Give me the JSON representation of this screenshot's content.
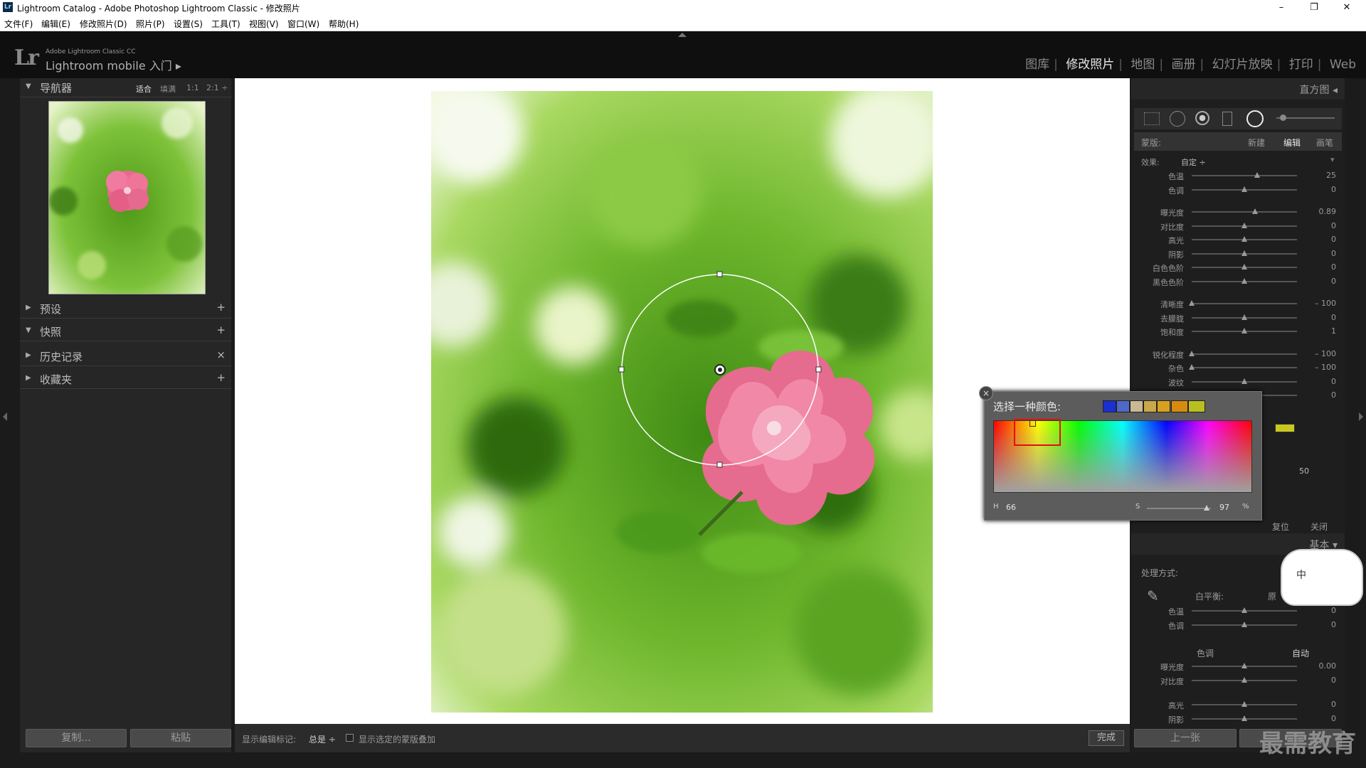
{
  "window": {
    "title": "Lightroom Catalog - Adobe Photoshop Lightroom Classic - 修改照片",
    "app_icon": "Lr",
    "controls": {
      "minimize": "–",
      "maximize": "❐",
      "close": "✕"
    }
  },
  "menu": [
    "文件(F)",
    "编辑(E)",
    "修改照片(D)",
    "照片(P)",
    "设置(S)",
    "工具(T)",
    "视图(V)",
    "窗口(W)",
    "帮助(H)"
  ],
  "brand": {
    "logo": "Lr",
    "small": "Adobe Lightroom Classic CC",
    "big": "Lightroom mobile 入门 ▸"
  },
  "modules": [
    "图库",
    "修改照片",
    "地图",
    "画册",
    "幻灯片放映",
    "打印",
    "Web"
  ],
  "active_module": "修改照片",
  "left_panel": {
    "navigator": {
      "label": "导航器",
      "zoom": [
        "适合",
        "填满",
        "1:1",
        "2:1 ÷"
      ]
    },
    "sections": [
      {
        "label": "预设",
        "action": "+"
      },
      {
        "label": "快照",
        "action": "+"
      },
      {
        "label": "历史记录",
        "action": "×"
      },
      {
        "label": "收藏夹",
        "action": "+"
      }
    ],
    "copy_button": "复制...",
    "paste_button": "粘贴"
  },
  "bottom_toolbar": {
    "show_markers_label": "显示编辑标记:",
    "show_markers_value": "总是 ÷",
    "overlay_label": "显示选定的蒙版叠加",
    "done_button": "完成"
  },
  "right_panel": {
    "histogram_label": "直方图 ◂",
    "mask": {
      "label": "蒙版:",
      "new": "新建",
      "edit": "编辑",
      "brush": "画笔"
    },
    "effect": {
      "label": "效果:",
      "value": "自定 ÷"
    },
    "sliders_group1": [
      {
        "label": "色温",
        "value": "25",
        "pos": 0.62
      },
      {
        "label": "色调",
        "value": "0",
        "pos": 0.5
      }
    ],
    "sliders_group2": [
      {
        "label": "曝光度",
        "value": "0.89",
        "pos": 0.6
      },
      {
        "label": "对比度",
        "value": "0",
        "pos": 0.5
      },
      {
        "label": "高光",
        "value": "0",
        "pos": 0.5
      },
      {
        "label": "阴影",
        "value": "0",
        "pos": 0.5
      },
      {
        "label": "白色色阶",
        "value": "0",
        "pos": 0.5
      },
      {
        "label": "黑色色阶",
        "value": "0",
        "pos": 0.5
      }
    ],
    "sliders_group3": [
      {
        "label": "清晰度",
        "value": "– 100",
        "pos": 0.0
      },
      {
        "label": "去朦胧",
        "value": "0",
        "pos": 0.5
      },
      {
        "label": "饱和度",
        "value": "1",
        "pos": 0.5
      }
    ],
    "sliders_group4": [
      {
        "label": "锐化程度",
        "value": "– 100",
        "pos": 0.0
      },
      {
        "label": "杂色",
        "value": "– 100",
        "pos": 0.0
      },
      {
        "label": "波纹",
        "value": "0",
        "pos": 0.5
      },
      {
        "label": "",
        "value": "0",
        "pos": 0.5
      }
    ],
    "feather_value": "50",
    "reset_button": "复位",
    "close_button": "关闭",
    "basic_label": "基本 ▾",
    "process_label": "处理方式:",
    "wb_label": "白平衡:",
    "wb_value": "原",
    "basic_sliders1": [
      {
        "label": "色温",
        "value": "0",
        "pos": 0.5
      },
      {
        "label": "色调",
        "value": "0",
        "pos": 0.5
      }
    ],
    "tone_label": "色调",
    "auto_button": "自动",
    "basic_sliders2": [
      {
        "label": "曝光度",
        "value": "0.00",
        "pos": 0.5
      },
      {
        "label": "对比度",
        "value": "0",
        "pos": 0.5
      }
    ],
    "basic_sliders3": [
      {
        "label": "高光",
        "value": "0",
        "pos": 0.5
      },
      {
        "label": "阴影",
        "value": "0",
        "pos": 0.5
      }
    ],
    "prev_button": "上一张"
  },
  "color_picker": {
    "title": "选择一种颜色:",
    "swatches": [
      "#1a2fd0",
      "#5068c8",
      "#c8b894",
      "#c9a84a",
      "#d8a020",
      "#d88a10",
      "#b8c020"
    ],
    "h_label": "H",
    "h_value": "66",
    "s_label": "S",
    "s_value": "97",
    "s_unit": "%",
    "close": "×",
    "current_color": "#c8c820"
  },
  "watermark": "最需教育",
  "ime_badge": "中"
}
